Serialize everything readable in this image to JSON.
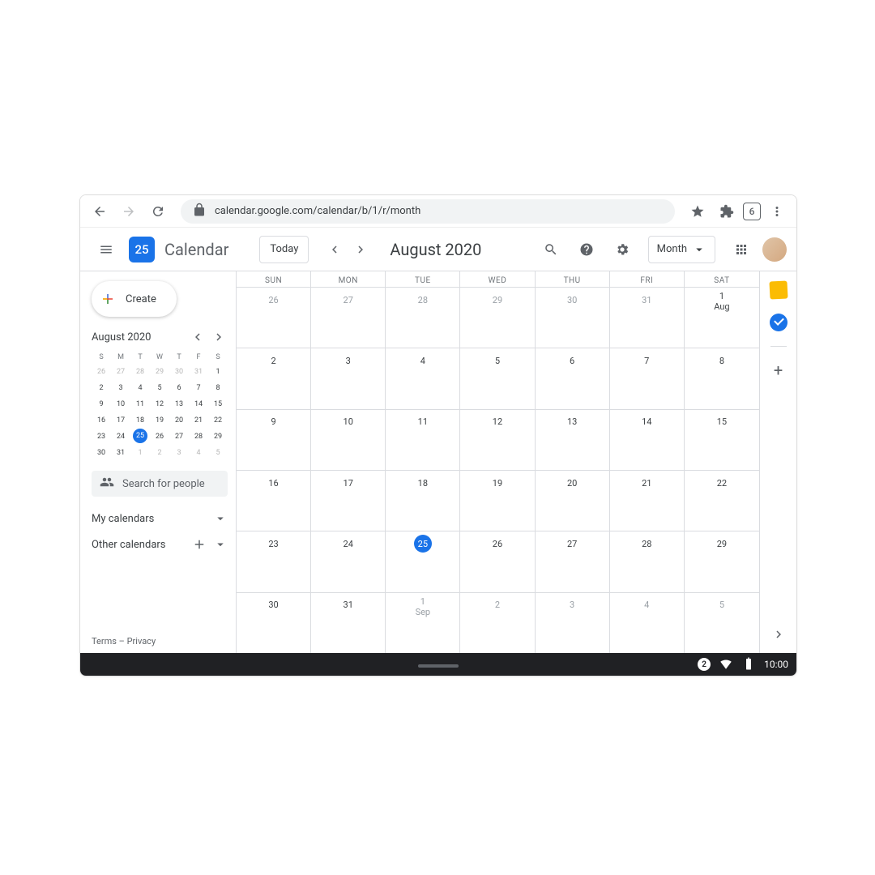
{
  "browser": {
    "url": "calendar.google.com/calendar/b/1/r/month",
    "tab_count": "6"
  },
  "header": {
    "logo_day": "25",
    "app_title": "Calendar",
    "today_label": "Today",
    "current_month": "August 2020",
    "view_label": "Month"
  },
  "sidebar": {
    "create_label": "Create",
    "mini_month": "August 2020",
    "day_headers": [
      "S",
      "M",
      "T",
      "W",
      "T",
      "F",
      "S"
    ],
    "mini_weeks": [
      [
        {
          "d": "26",
          "f": true
        },
        {
          "d": "27",
          "f": true
        },
        {
          "d": "28",
          "f": true
        },
        {
          "d": "29",
          "f": true
        },
        {
          "d": "30",
          "f": true
        },
        {
          "d": "31",
          "f": true
        },
        {
          "d": "1"
        }
      ],
      [
        {
          "d": "2"
        },
        {
          "d": "3"
        },
        {
          "d": "4"
        },
        {
          "d": "5"
        },
        {
          "d": "6"
        },
        {
          "d": "7"
        },
        {
          "d": "8"
        }
      ],
      [
        {
          "d": "9"
        },
        {
          "d": "10"
        },
        {
          "d": "11"
        },
        {
          "d": "12"
        },
        {
          "d": "13"
        },
        {
          "d": "14"
        },
        {
          "d": "15"
        }
      ],
      [
        {
          "d": "16"
        },
        {
          "d": "17"
        },
        {
          "d": "18"
        },
        {
          "d": "19"
        },
        {
          "d": "20"
        },
        {
          "d": "21"
        },
        {
          "d": "22"
        }
      ],
      [
        {
          "d": "23"
        },
        {
          "d": "24"
        },
        {
          "d": "25",
          "today": true
        },
        {
          "d": "26"
        },
        {
          "d": "27"
        },
        {
          "d": "28"
        },
        {
          "d": "29"
        }
      ],
      [
        {
          "d": "30"
        },
        {
          "d": "31"
        },
        {
          "d": "1",
          "f": true
        },
        {
          "d": "2",
          "f": true
        },
        {
          "d": "3",
          "f": true
        },
        {
          "d": "4",
          "f": true
        },
        {
          "d": "5",
          "f": true
        }
      ]
    ],
    "search_placeholder": "Search for people",
    "my_calendars": "My calendars",
    "other_calendars": "Other calendars",
    "terms": "Terms",
    "privacy": "Privacy"
  },
  "grid": {
    "day_headers": [
      "SUN",
      "MON",
      "TUE",
      "WED",
      "THU",
      "FRI",
      "SAT"
    ],
    "weeks": [
      [
        {
          "d": "26",
          "f": true
        },
        {
          "d": "27",
          "f": true
        },
        {
          "d": "28",
          "f": true
        },
        {
          "d": "29",
          "f": true
        },
        {
          "d": "30",
          "f": true
        },
        {
          "d": "31",
          "f": true
        },
        {
          "d": "1 Aug"
        }
      ],
      [
        {
          "d": "2"
        },
        {
          "d": "3"
        },
        {
          "d": "4"
        },
        {
          "d": "5"
        },
        {
          "d": "6"
        },
        {
          "d": "7"
        },
        {
          "d": "8"
        }
      ],
      [
        {
          "d": "9"
        },
        {
          "d": "10"
        },
        {
          "d": "11"
        },
        {
          "d": "12"
        },
        {
          "d": "13"
        },
        {
          "d": "14"
        },
        {
          "d": "15"
        }
      ],
      [
        {
          "d": "16"
        },
        {
          "d": "17"
        },
        {
          "d": "18"
        },
        {
          "d": "19"
        },
        {
          "d": "20"
        },
        {
          "d": "21"
        },
        {
          "d": "22"
        }
      ],
      [
        {
          "d": "23"
        },
        {
          "d": "24"
        },
        {
          "d": "25",
          "today": true
        },
        {
          "d": "26"
        },
        {
          "d": "27"
        },
        {
          "d": "28"
        },
        {
          "d": "29"
        }
      ],
      [
        {
          "d": "30"
        },
        {
          "d": "31"
        },
        {
          "d": "1 Sep",
          "f": true
        },
        {
          "d": "2",
          "f": true
        },
        {
          "d": "3",
          "f": true
        },
        {
          "d": "4",
          "f": true
        },
        {
          "d": "5",
          "f": true
        }
      ]
    ]
  },
  "taskbar": {
    "notif": "2",
    "time": "10:00"
  }
}
